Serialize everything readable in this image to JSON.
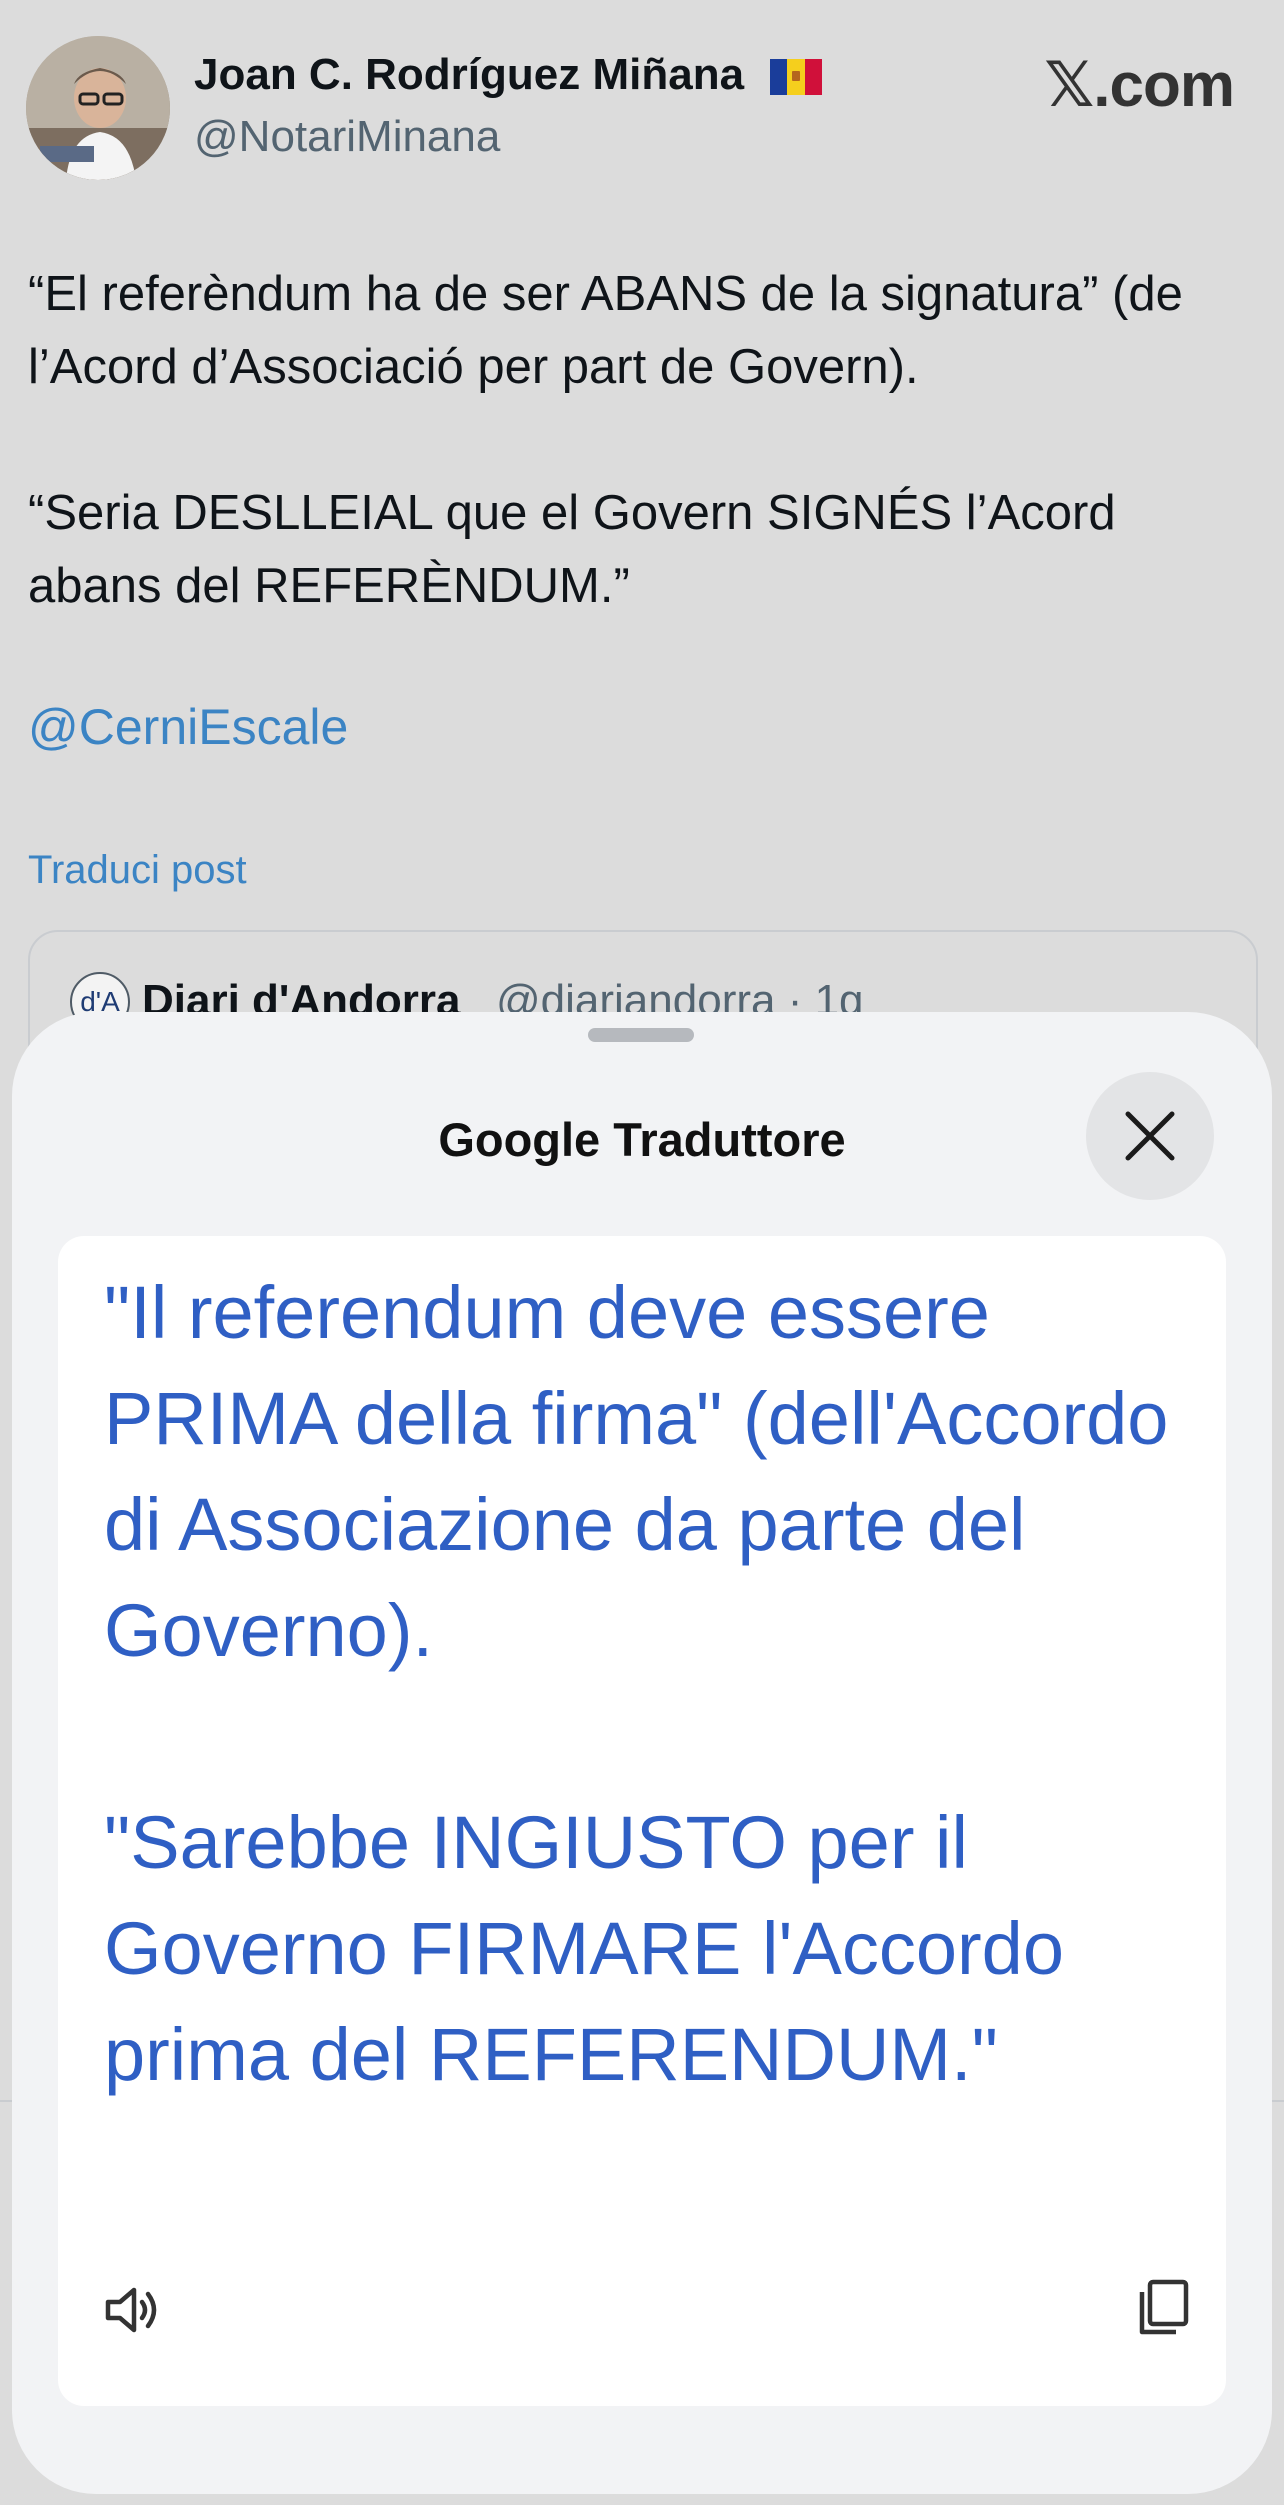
{
  "tweet": {
    "author_name": "Joan C. Rodríguez Miñana",
    "author_handle": "@NotariMinana",
    "brand": "𝕏.com",
    "text": "“El referèndum ha de ser ABANS de la signatura” (de l’Acord d’Associació per part de Govern).\n\n“Seria DESLLEIAL que el Govern SIGNÉS l’Acord abans del REFERÈNDUM.”",
    "mention": "@CerniEscale",
    "translate_link": "Traduci post",
    "quoted": {
      "avatar_text": "d'A",
      "name": "Diari d'Andorra",
      "meta": "@diariandorra · 1g"
    },
    "flag_icon": "andorra-flag-icon"
  },
  "translate_sheet": {
    "title": "Google Traduttore",
    "translation": "\"Il referendum deve essere PRIMA della firma\" (dell'Accordo di Associazione da parte del Governo).\n\n\"Sarebbe INGIUSTO per il Governo FIRMARE l'Accordo prima del REFERENDUM.\"",
    "close_icon": "close-icon",
    "speaker_icon": "speaker-icon",
    "copy_icon": "copy-icon"
  },
  "colors": {
    "link": "#3b84c4",
    "translation_text": "#2f5fc4",
    "background": "#dcdcdc",
    "sheet": "#f2f3f5"
  }
}
